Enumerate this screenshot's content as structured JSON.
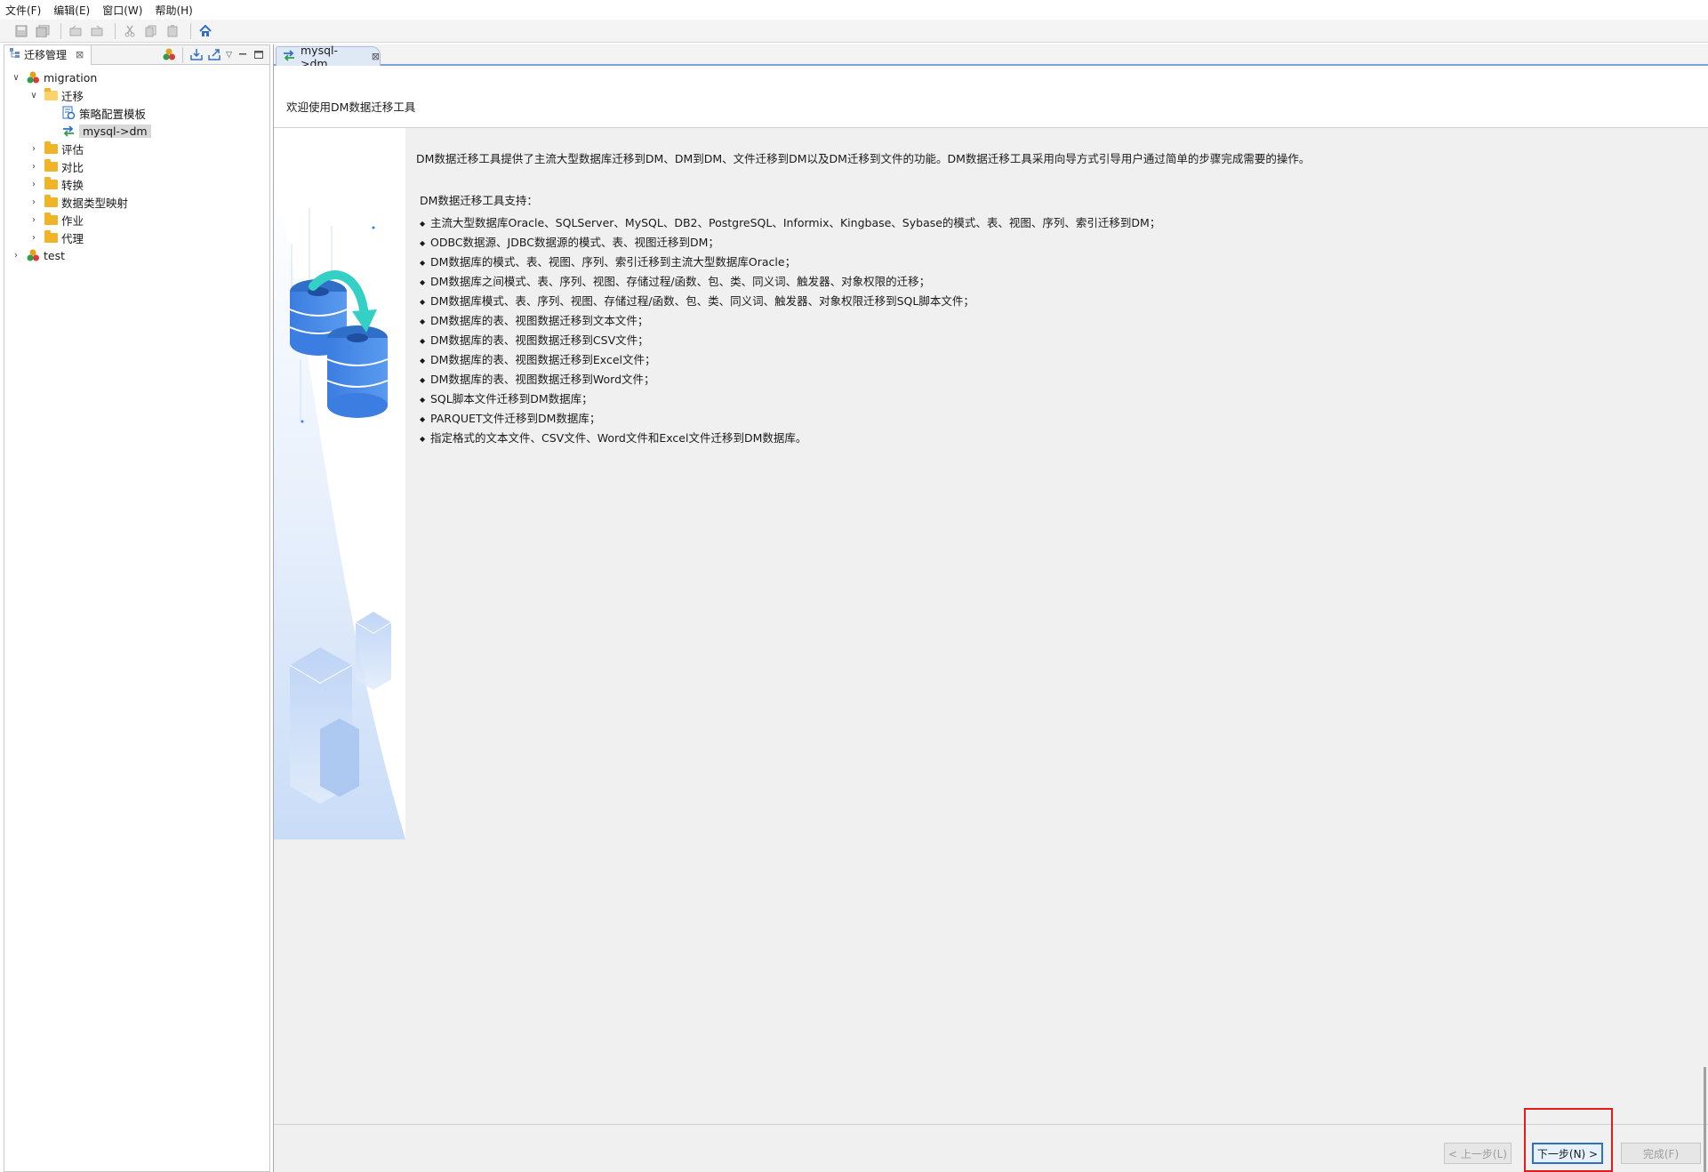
{
  "menu": [
    "文件(F)",
    "编辑(E)",
    "窗口(W)",
    "帮助(H)"
  ],
  "left_panel": {
    "tab_label": "迁移管理",
    "tree": [
      {
        "label": "migration",
        "expanded": true,
        "icon": "project-icon",
        "level": 0
      },
      {
        "label": "迁移",
        "expanded": true,
        "icon": "folder-open-icon",
        "level": 1
      },
      {
        "label": "策略配置模板",
        "icon": "template-icon",
        "level": 2
      },
      {
        "label": "mysql->dm",
        "icon": "migration-task-icon",
        "level": 2,
        "selected": true
      },
      {
        "label": "评估",
        "expanded": false,
        "icon": "folder-icon",
        "level": 1
      },
      {
        "label": "对比",
        "expanded": false,
        "icon": "folder-icon",
        "level": 1
      },
      {
        "label": "转换",
        "expanded": false,
        "icon": "folder-icon",
        "level": 1
      },
      {
        "label": "数据类型映射",
        "expanded": false,
        "icon": "folder-icon",
        "level": 1
      },
      {
        "label": "作业",
        "expanded": false,
        "icon": "folder-icon",
        "level": 1
      },
      {
        "label": "代理",
        "expanded": false,
        "icon": "folder-icon",
        "level": 1
      },
      {
        "label": "test",
        "expanded": false,
        "icon": "project-icon",
        "level": 0
      }
    ]
  },
  "editor": {
    "tab_label": "mysql->dm",
    "wizard_title": "欢迎使用DM数据迁移工具",
    "intro": "DM数据迁移工具提供了主流大型数据库迁移到DM、DM到DM、文件迁移到DM以及DM迁移到文件的功能。DM数据迁移工具采用向导方式引导用户通过简单的步骤完成需要的操作。",
    "support_title": "DM数据迁移工具支持：",
    "features": [
      "主流大型数据库Oracle、SQLServer、MySQL、DB2、PostgreSQL、Informix、Kingbase、Sybase的模式、表、视图、序列、索引迁移到DM；",
      "ODBC数据源、JDBC数据源的模式、表、视图迁移到DM；",
      "DM数据库的模式、表、视图、序列、索引迁移到主流大型数据库Oracle；",
      "DM数据库之间模式、表、序列、视图、存储过程/函数、包、类、同义词、触发器、对象权限的迁移；",
      "DM数据库模式、表、序列、视图、存储过程/函数、包、类、同义词、触发器、对象权限迁移到SQL脚本文件；",
      "DM数据库的表、视图数据迁移到文本文件；",
      "DM数据库的表、视图数据迁移到CSV文件；",
      "DM数据库的表、视图数据迁移到Excel文件；",
      "DM数据库的表、视图数据迁移到Word文件；",
      "SQL脚本文件迁移到DM数据库；",
      "PARQUET文件迁移到DM数据库；",
      "指定格式的文本文件、CSV文件、Word文件和Excel文件迁移到DM数据库。"
    ],
    "buttons": {
      "back": "< 上一步(L)",
      "next": "下一步(N) >",
      "finish": "完成(F)"
    }
  },
  "colors": {
    "accent": "#2f6fc8",
    "highlight": "#e21b1b",
    "folder": "#f0b429",
    "panel_bg": "#f0f0f0"
  }
}
